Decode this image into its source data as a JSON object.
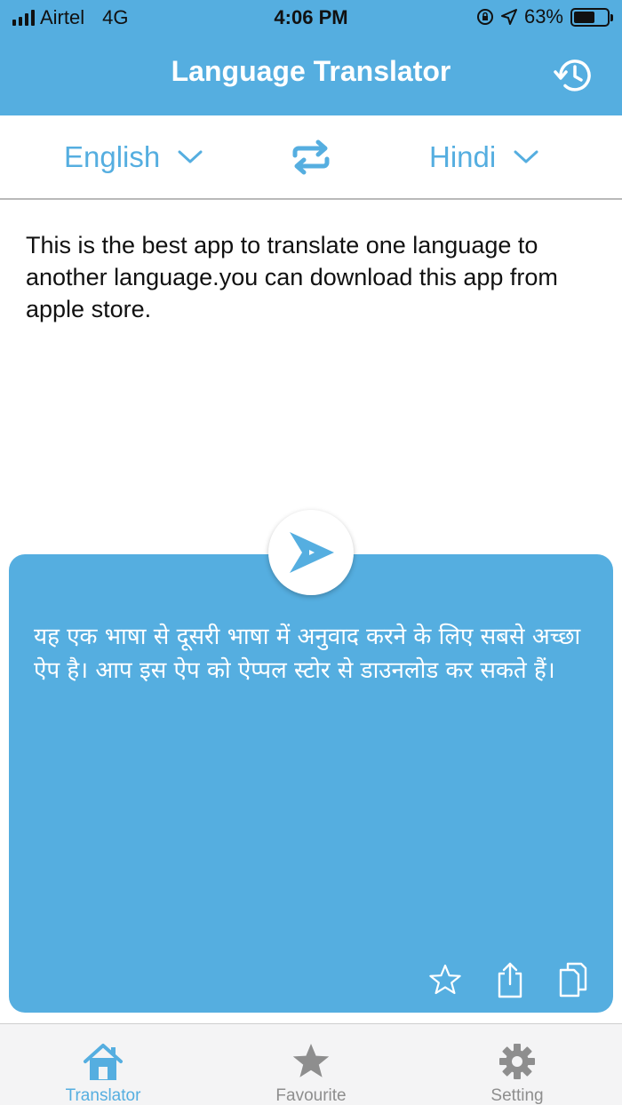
{
  "status_bar": {
    "carrier": "Airtel",
    "network": "4G",
    "time": "4:06 PM",
    "battery": "63%",
    "battery_level": 0.63
  },
  "header": {
    "title": "Language Translator",
    "history_icon": "history-icon"
  },
  "languages": {
    "source": "English",
    "target": "Hindi",
    "swap_icon": "swap-arrows-icon"
  },
  "input": {
    "text": "This is the best app to translate one language to another language.you can download this app from apple store."
  },
  "output": {
    "text": "यह एक भाषा से दूसरी भाषा में अनुवाद करने के लिए सबसे अच्छा ऐप है। आप इस ऐप को ऐप्पल स्टोर से डाउनलोड कर सकते हैं।",
    "actions": [
      "star-icon",
      "share-icon",
      "copy-icon"
    ]
  },
  "tabs": [
    {
      "label": "Translator",
      "icon": "home-icon",
      "active": true
    },
    {
      "label": "Favourite",
      "icon": "star-icon",
      "active": false
    },
    {
      "label": "Setting",
      "icon": "gear-icon",
      "active": false
    }
  ],
  "colors": {
    "accent": "#55aee0",
    "inactive_tab": "#8e8e8e"
  }
}
